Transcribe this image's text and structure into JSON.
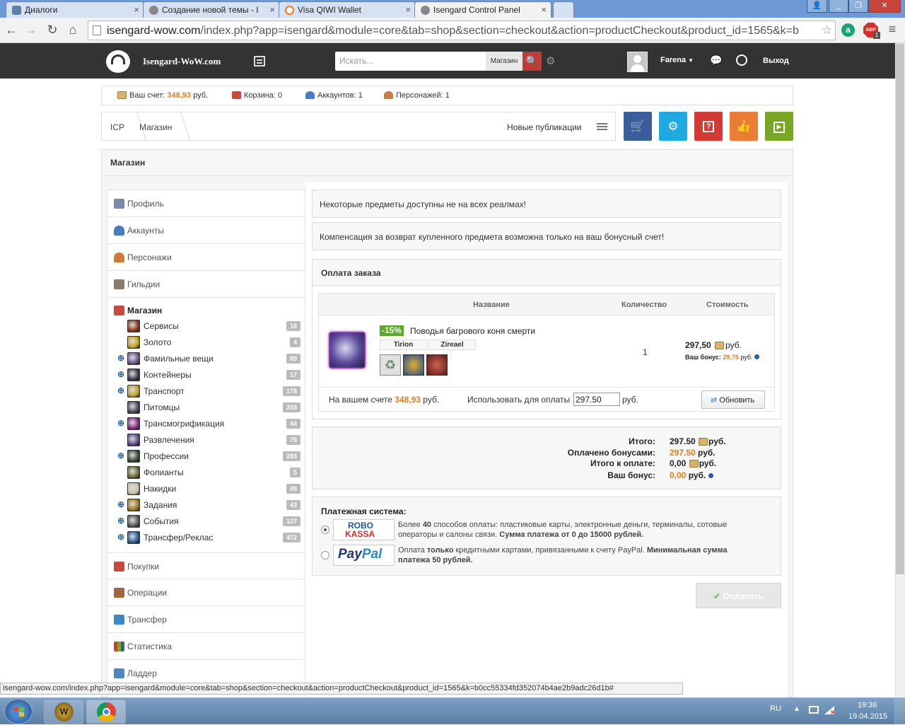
{
  "browser": {
    "tabs": [
      {
        "label": "Диалоги",
        "icon": "vk-icon",
        "color": "#5b7fa6"
      },
      {
        "label": "Создание новой темы - I",
        "icon": "isengard-icon",
        "color": "#777777"
      },
      {
        "label": "Visa QIWI Wallet",
        "icon": "qiwi-icon",
        "color": "#f07a20"
      },
      {
        "label": "Isengard Control Panel",
        "icon": "isengard-icon",
        "color": "#777777"
      }
    ],
    "url_host": "isengard-wow.com",
    "url_rest": "/index.php?app=isengard&module=core&tab=shop&section=checkout&action=productCheckout&product_id=1565&k=b",
    "abp_label": "ABP",
    "abp_count": "1"
  },
  "header": {
    "site_name": "Isengard-WoW.com",
    "search_placeholder": "Искать...",
    "search_scope": "Магазин",
    "username": "Farena",
    "logout": "Выход"
  },
  "infobar": {
    "balance_label": "Ваш счет:",
    "balance_value": "348,93",
    "balance_unit": "руб.",
    "cart": "Корзина: 0",
    "accounts": "Аккаунтов: 1",
    "characters": "Персонажей: 1"
  },
  "breadcrumb": {
    "items": [
      "ICP",
      "Магазин"
    ],
    "new_posts": "Новые публикации"
  },
  "quick_buttons": [
    {
      "icon": "cart-icon",
      "color": "#3a5e9c"
    },
    {
      "icon": "gear-icon",
      "color": "#1fa9e1"
    },
    {
      "icon": "help-icon",
      "color": "#d23a35"
    },
    {
      "icon": "thumbs-up-icon",
      "color": "#ea7c35"
    },
    {
      "icon": "play-icon",
      "color": "#79a723"
    }
  ],
  "page": {
    "title": "Магазин"
  },
  "sidebar": {
    "top_items": [
      {
        "label": "Профиль",
        "icon": "profile-icon"
      },
      {
        "label": "Аккаунты",
        "icon": "accounts-icon"
      },
      {
        "label": "Персонажи",
        "icon": "characters-icon"
      },
      {
        "label": "Гильдии",
        "icon": "guilds-icon"
      }
    ],
    "shop_label": "Магазин",
    "shop_items": [
      {
        "label": "Сервисы",
        "count": "18",
        "expand": false,
        "color": "#8a3a20"
      },
      {
        "label": "Золото",
        "count": "4",
        "expand": false,
        "color": "#c9a018"
      },
      {
        "label": "Фамильные вещи",
        "count": "89",
        "expand": true,
        "color": "#6b5a8a"
      },
      {
        "label": "Контейнеры",
        "count": "17",
        "expand": true,
        "color": "#3a3a4a"
      },
      {
        "label": "Транспорт",
        "count": "178",
        "expand": true,
        "color": "#c2a030"
      },
      {
        "label": "Питомцы",
        "count": "203",
        "expand": false,
        "color": "#4a4a5a"
      },
      {
        "label": "Трансмогрификация",
        "count": "44",
        "expand": true,
        "color": "#8a2a8a"
      },
      {
        "label": "Развлечения",
        "count": "75",
        "expand": false,
        "color": "#5a4a8a"
      },
      {
        "label": "Профессии",
        "count": "283",
        "expand": true,
        "color": "#3a4a3a"
      },
      {
        "label": "Фолианты",
        "count": "5",
        "expand": false,
        "color": "#6a6a3a"
      },
      {
        "label": "Накидки",
        "count": "45",
        "expand": false,
        "color": "#c8c0a8"
      },
      {
        "label": "Задания",
        "count": "43",
        "expand": true,
        "color": "#a07a20"
      },
      {
        "label": "События",
        "count": "127",
        "expand": true,
        "color": "#5a5a5a"
      },
      {
        "label": "Трансфер/Реклас",
        "count": "472",
        "expand": true,
        "color": "#2a5a9a"
      }
    ],
    "bottom_items": [
      {
        "label": "Покупки",
        "icon": "purchases-icon"
      },
      {
        "label": "Операции",
        "icon": "operations-icon"
      },
      {
        "label": "Трансфер",
        "icon": "transfer-icon"
      },
      {
        "label": "Статистика",
        "icon": "statistics-icon"
      },
      {
        "label": "Ладдер",
        "icon": "ladder-icon"
      }
    ]
  },
  "notices": [
    "Некоторые предметы доступны не на всех реалмах!",
    "Компенсация за возврат купленного предмета возможна только на ваш бонусный счет!"
  ],
  "order": {
    "title": "Оплата заказа",
    "col_name": "Название",
    "col_qty": "Количество",
    "col_price": "Стоимость",
    "discount": "-15%",
    "product_name": "Поводья багрового коня смерти",
    "realm": "Tirion",
    "character": "Zireael",
    "qty": "1",
    "price": "297,50",
    "price_unit": "руб.",
    "bonus_label": "Ваш бонус:",
    "bonus_value": "29,75",
    "bonus_unit": "руб.",
    "account_label": "На вашем счете",
    "account_value": "348,93",
    "account_unit": "руб.",
    "use_label": "Использовать для оплаты",
    "use_value": "297.50",
    "use_unit": "руб.",
    "refresh": "Обновить"
  },
  "totals": {
    "total_label": "Итого:",
    "total_value": "297.50",
    "total_unit": "руб.",
    "paid_label": "Оплачено бонусами:",
    "paid_value": "297.50",
    "paid_unit": "руб.",
    "due_label": "Итого к оплате:",
    "due_value": "0,00",
    "due_unit": "руб.",
    "bonus_label": "Ваш бонус:",
    "bonus_value": "0,00",
    "bonus_unit": "руб."
  },
  "payment": {
    "title": "Платежная система:",
    "robokassa_logo_1": "ROBO",
    "robokassa_logo_2": "KASSA",
    "robokassa_pre": "Более ",
    "robokassa_count": "40",
    "robokassa_text": " способов оплаты: пластиковые карты, электронные деньги, терминалы, сотовые операторы и салоны связи. ",
    "robokassa_bold": "Сумма платежа от 0 до 15000 рублей.",
    "paypal_logo_1": "Pay",
    "paypal_logo_2": "Pal",
    "paypal_pre": "Оплата ",
    "paypal_bold1": "только",
    "paypal_text": " кредитными картами, привязанными к счету PayPal. ",
    "paypal_bold2": "Минимальная сумма платежа 50 рублей.",
    "pay_button": "Оплатить"
  },
  "statusbar": {
    "url": "isengard-wow.com/index.php?app=isengard&module=core&tab=shop&section=checkout&action=productCheckout&product_id=1565&k=b0cc55334fd352074b4ae2b9adc26d1b#"
  },
  "taskbar": {
    "lang": "RU",
    "time": "19:36",
    "date": "19.04.2015"
  },
  "colors": {
    "accent_orange": "#e57e1e",
    "discount_green": "#5aa828",
    "header_dark": "#333333"
  }
}
